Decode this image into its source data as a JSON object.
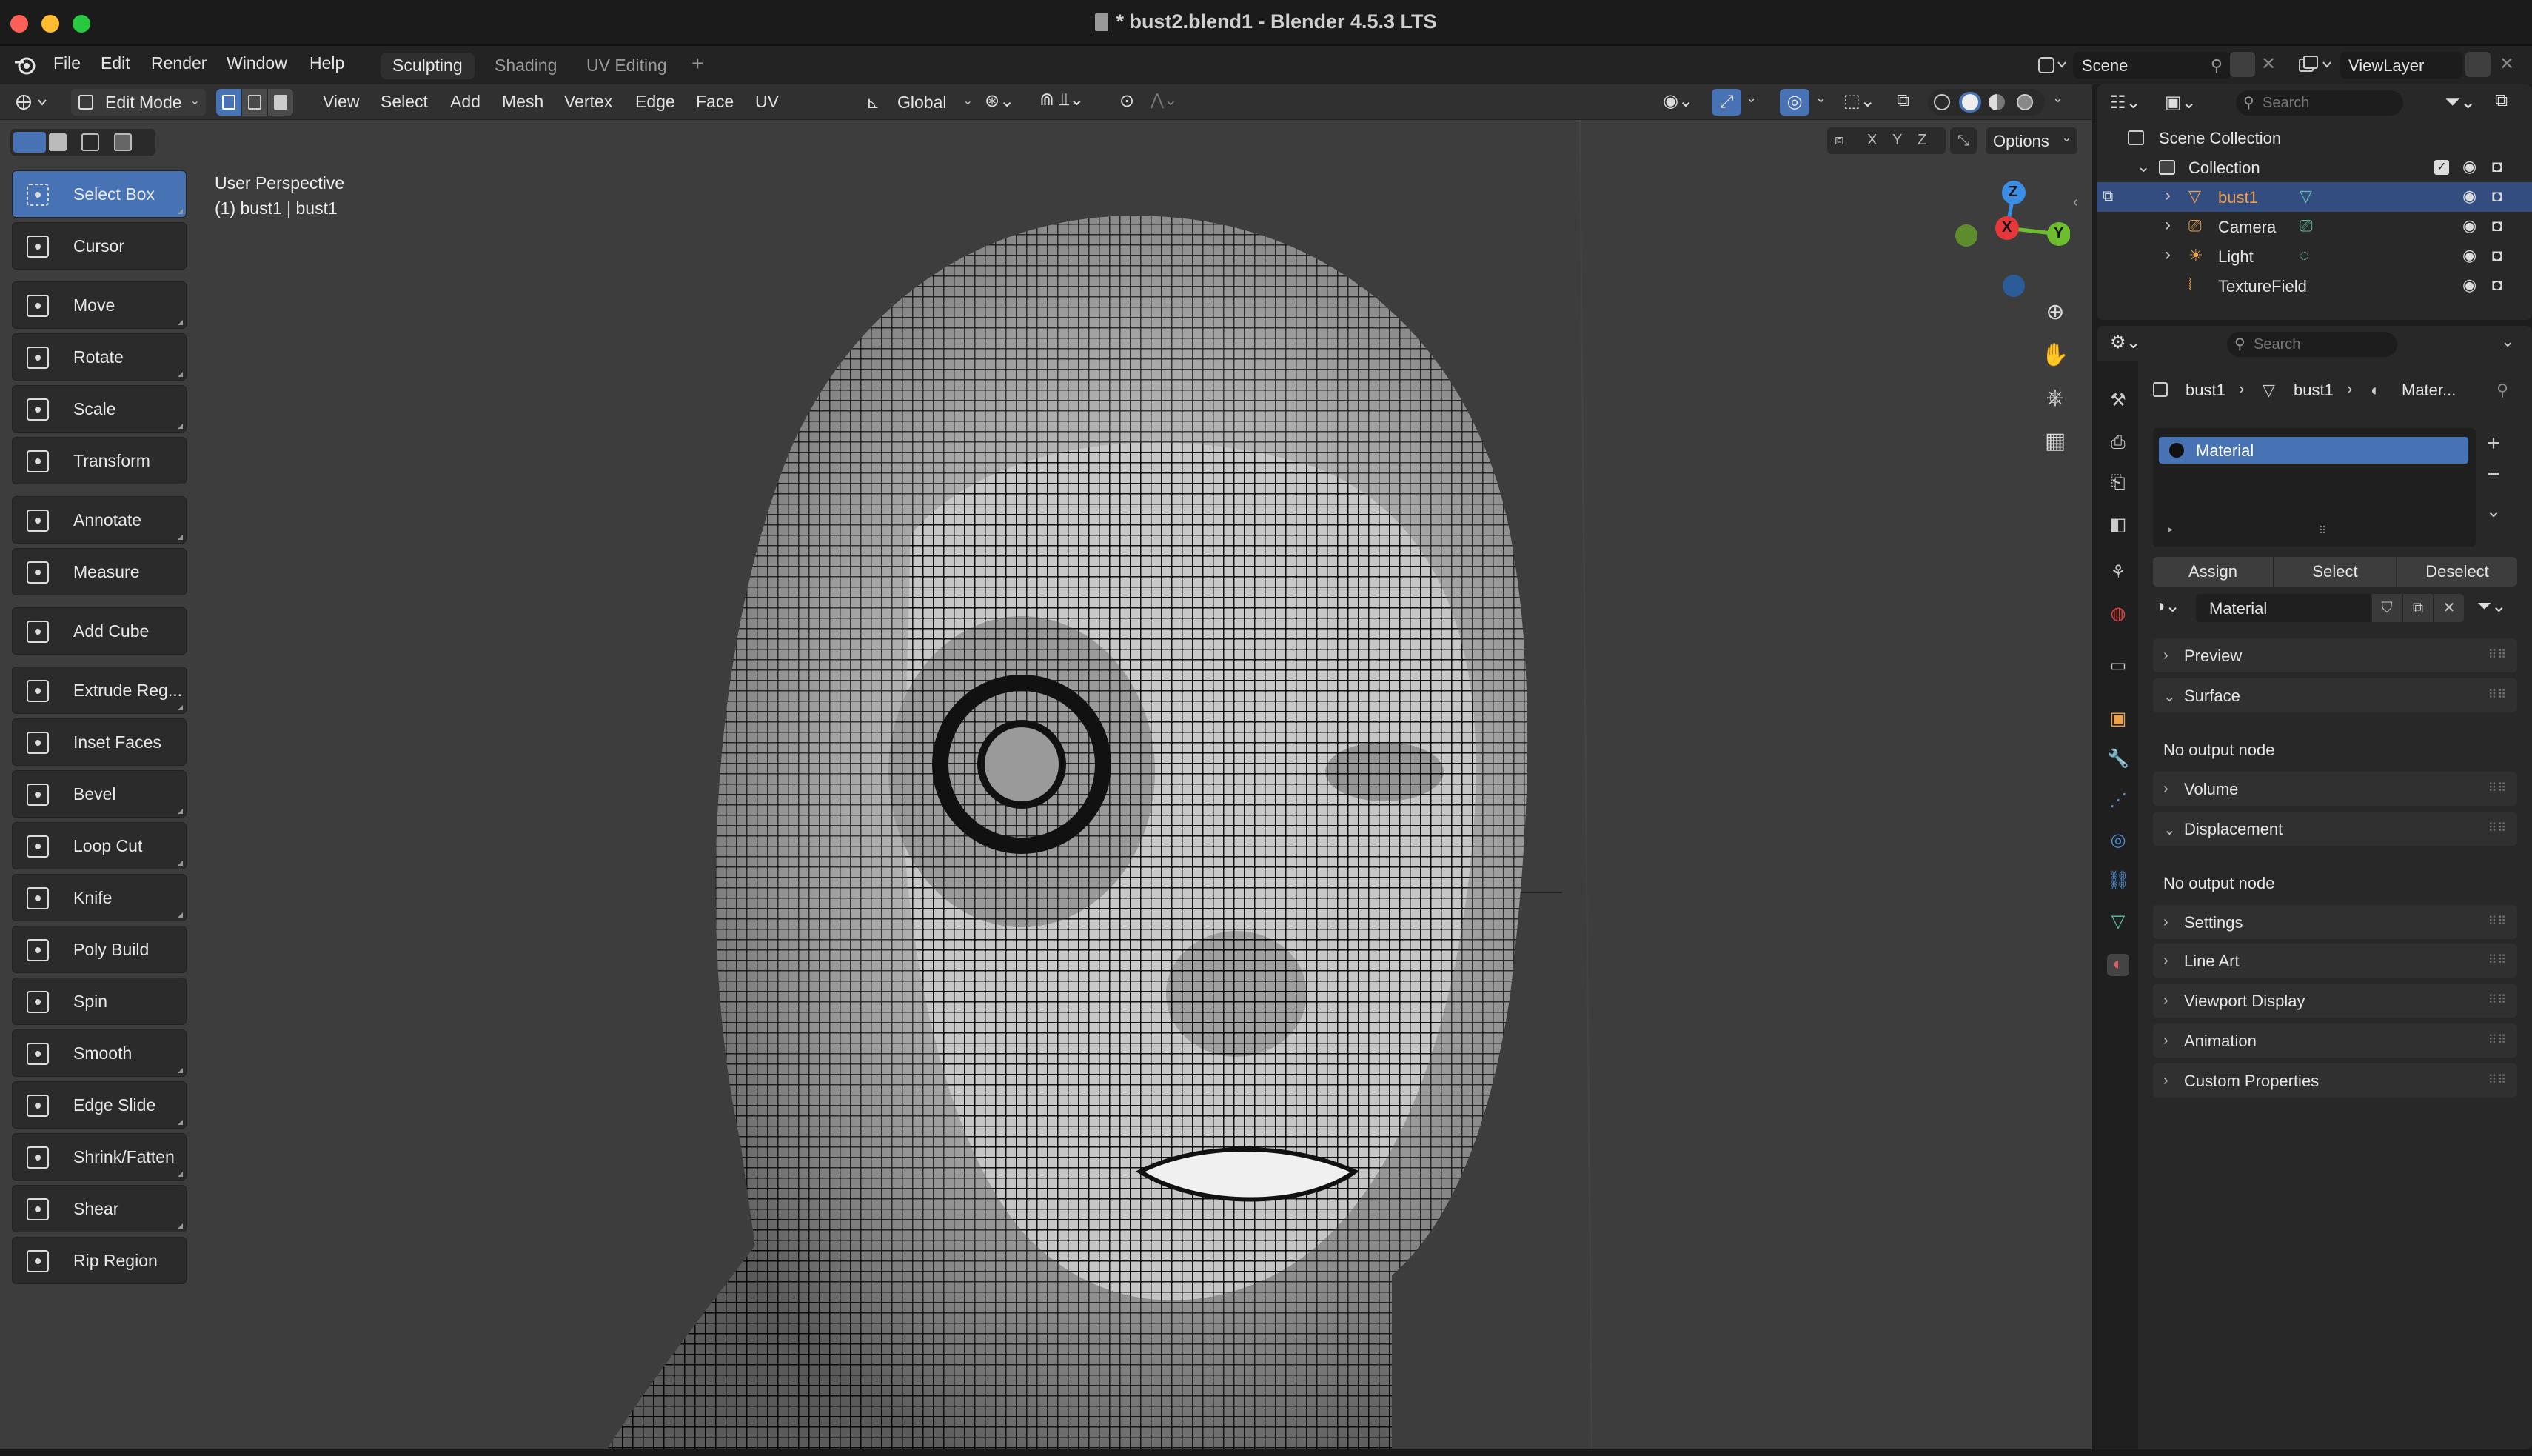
{
  "window": {
    "title": "* bust2.blend1 - Blender 4.5.3 LTS"
  },
  "menu": {
    "items": [
      "File",
      "Edit",
      "Render",
      "Window",
      "Help"
    ]
  },
  "workspaces": {
    "tabs": [
      "Sculpting",
      "Shading",
      "UV Editing"
    ],
    "active": "Sculpting",
    "add": "+"
  },
  "scene": {
    "name": "Scene",
    "view_layer": "ViewLayer"
  },
  "header": {
    "mode": "Edit Mode",
    "menus": [
      "View",
      "Select",
      "Add",
      "Mesh",
      "Vertex",
      "Edge",
      "Face",
      "UV"
    ],
    "orientation": "Global",
    "options": "Options",
    "axes": [
      "X",
      "Y",
      "Z"
    ]
  },
  "viewport": {
    "perspective": "User Perspective",
    "object_info": "(1) bust1 | bust1"
  },
  "gizmo": {
    "z": "Z",
    "x": "X",
    "y": "Y"
  },
  "tools": [
    {
      "label": "Select Box",
      "icon": "select-box-icon",
      "active": true
    },
    {
      "label": "Cursor",
      "icon": "cursor-icon"
    },
    {
      "label": "Move",
      "icon": "move-icon"
    },
    {
      "label": "Rotate",
      "icon": "rotate-icon"
    },
    {
      "label": "Scale",
      "icon": "scale-icon"
    },
    {
      "label": "Transform",
      "icon": "transform-icon"
    },
    {
      "label": "Annotate",
      "icon": "annotate-icon"
    },
    {
      "label": "Measure",
      "icon": "measure-icon"
    },
    {
      "label": "Add Cube",
      "icon": "add-cube-icon"
    },
    {
      "label": "Extrude Reg...",
      "icon": "extrude-icon"
    },
    {
      "label": "Inset Faces",
      "icon": "inset-faces-icon"
    },
    {
      "label": "Bevel",
      "icon": "bevel-icon"
    },
    {
      "label": "Loop Cut",
      "icon": "loop-cut-icon"
    },
    {
      "label": "Knife",
      "icon": "knife-icon"
    },
    {
      "label": "Poly Build",
      "icon": "poly-build-icon"
    },
    {
      "label": "Spin",
      "icon": "spin-icon"
    },
    {
      "label": "Smooth",
      "icon": "smooth-icon"
    },
    {
      "label": "Edge Slide",
      "icon": "edge-slide-icon"
    },
    {
      "label": "Shrink/Fatten",
      "icon": "shrink-fatten-icon"
    },
    {
      "label": "Shear",
      "icon": "shear-icon"
    },
    {
      "label": "Rip Region",
      "icon": "rip-region-icon"
    }
  ],
  "outliner": {
    "search_placeholder": "Search",
    "root": "Scene Collection",
    "collection": "Collection",
    "items": [
      {
        "name": "bust1",
        "icon": "mesh-icon",
        "selected": true
      },
      {
        "name": "Camera",
        "icon": "camera-icon"
      },
      {
        "name": "Light",
        "icon": "light-icon"
      },
      {
        "name": "TextureField",
        "icon": "force-field-icon"
      }
    ]
  },
  "properties": {
    "search_placeholder": "Search",
    "breadcrumb": [
      "bust1",
      "bust1",
      "Mater..."
    ],
    "slot": "Material",
    "buttons": [
      "Assign",
      "Select",
      "Deselect"
    ],
    "material_name": "Material",
    "panels": [
      "Preview",
      "Surface",
      "Volume",
      "Displacement",
      "Settings",
      "Line Art",
      "Viewport Display",
      "Animation",
      "Custom Properties"
    ],
    "no_output": "No output node"
  },
  "colors": {
    "accent": "#4772b3",
    "selected_text": "#f0a048",
    "x_axis": "#e5383b",
    "y_axis": "#6ebd2f",
    "z_axis": "#3a8ee6"
  }
}
